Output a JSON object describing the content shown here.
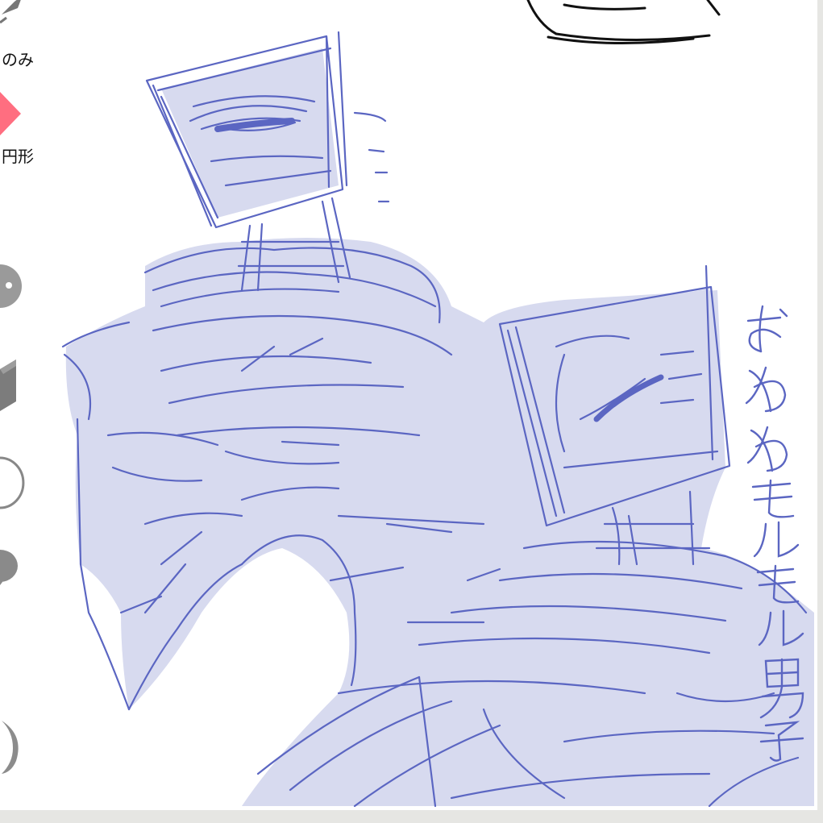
{
  "toolbar": {
    "tools": [
      {
        "id": "pen-only",
        "label": "のみ",
        "icon": "pen-tip-icon"
      },
      {
        "id": "circle-shape",
        "label": "円形",
        "icon": "diamond-icon"
      },
      {
        "icon": "palette-icon"
      },
      {
        "icon": "cube-icon"
      },
      {
        "icon": "circle-outline-icon"
      },
      {
        "icon": "speech-bubble-icon"
      },
      {
        "icon": "crescent-icon"
      }
    ]
  },
  "canvas": {
    "handwritten_text": "おめめモルモル男子"
  },
  "colors": {
    "ink": "#5b66c2",
    "fill": "#d7daef",
    "accent": "#ff6e80",
    "icon_gray": "#8a8a8a",
    "panel": "#e6e6e3"
  }
}
